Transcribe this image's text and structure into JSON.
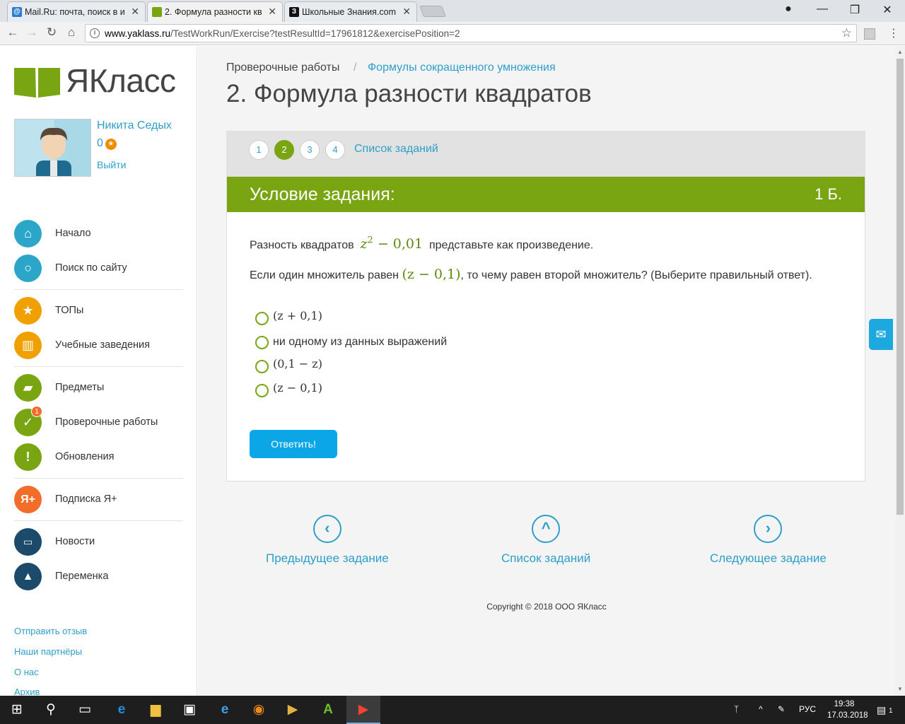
{
  "browser": {
    "tabs": [
      {
        "title": "Mail.Ru: почта, поиск в и",
        "favicon": "@"
      },
      {
        "title": "2. Формула разности кв",
        "favicon": ""
      },
      {
        "title": "Школьные Знания.com",
        "favicon": "З"
      }
    ],
    "url_host": "www.yaklass.ru",
    "url_path": "/TestWorkRun/Exercise?testResultId=17961812&exercisePosition=2",
    "window_controls": {
      "account": "account-icon",
      "minimize": "—",
      "restore": "❐",
      "close": "✕"
    }
  },
  "sidebar": {
    "logo_text": "ЯКласс",
    "user": {
      "name": "Никита Седых",
      "points": "0",
      "logout": "Выйти"
    },
    "nav": [
      {
        "label": "Начало",
        "icon": "home-icon",
        "color": "#2ba6c9"
      },
      {
        "label": "Поиск по сайту",
        "icon": "search-icon",
        "color": "#2ba6c9"
      },
      {
        "label": "ТОПы",
        "icon": "star-icon",
        "color": "#f0a000"
      },
      {
        "label": "Учебные заведения",
        "icon": "school-icon",
        "color": "#f0a000"
      },
      {
        "label": "Предметы",
        "icon": "book-icon",
        "color": "#7aa513"
      },
      {
        "label": "Проверочные работы",
        "icon": "check-icon",
        "color": "#7aa513",
        "badge": "1"
      },
      {
        "label": "Обновления",
        "icon": "exclamation-icon",
        "color": "#7aa513"
      },
      {
        "label": "Подписка Я+",
        "icon": "ya-plus-icon",
        "color": "#f26c2a"
      },
      {
        "label": "Новости",
        "icon": "chat-icon",
        "color": "#1b4a6b"
      },
      {
        "label": "Переменка",
        "icon": "bell-icon",
        "color": "#1b4a6b"
      }
    ],
    "footer_links": [
      "Отправить отзыв",
      "Наши партнёры",
      "О нас",
      "Архив"
    ]
  },
  "main": {
    "breadcrumb": {
      "root": "Проверочные работы",
      "sep": "/",
      "current": "Формулы сокращенного умножения"
    },
    "title": "2. Формула разности квадратов",
    "pager": {
      "pages": [
        "1",
        "2",
        "3",
        "4"
      ],
      "current": "2",
      "list_label": "Список заданий"
    },
    "task": {
      "header": "Условие задания:",
      "points": "1 Б.",
      "q1_before": "Разность квадратов",
      "q1_math_var": "z",
      "q1_math_exp": "2",
      "q1_math_rest": " − 0,01",
      "q1_after": "представьте как произведение.",
      "q2_before": "Если один множитель равен",
      "q2_math": "(z − 0,1)",
      "q2_after": ", то чему равен второй множитель? (Выберите правильный ответ).",
      "options": [
        "(z + 0,1)",
        "ни одному из данных выражений",
        "(0,1 − z)",
        "(z − 0,1)"
      ],
      "submit": "Ответить!"
    },
    "nav": {
      "prev": "Предыдущее задание",
      "list": "Список заданий",
      "next": "Следующее задание"
    },
    "copyright": "Copyright © 2018 ООО ЯКласс"
  },
  "taskbar": {
    "lang": "РУС",
    "time": "19:38",
    "date": "17.03.2018",
    "notifications": "1"
  },
  "colors": {
    "green": "#7aa513",
    "blue": "#2e9fc9",
    "button": "#0aa6e5"
  }
}
